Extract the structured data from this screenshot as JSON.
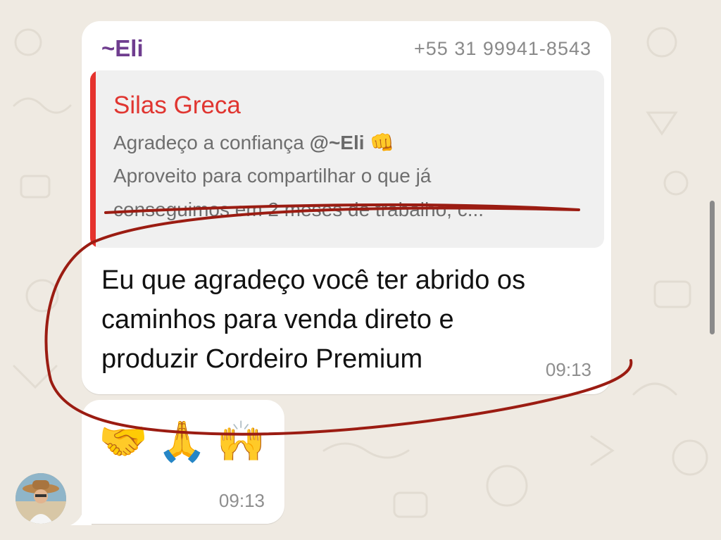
{
  "colors": {
    "wallpaper": "#efeae2",
    "bubble": "#ffffff",
    "sender_name": "#6f3d8f",
    "quote_author": "#e03530",
    "quote_bar": "#e5322d",
    "annotation_stroke": "#9b1c12"
  },
  "message1": {
    "sender_name": "~Eli",
    "sender_phone": "+55 31 99941-8543",
    "quoted": {
      "author": "Silas Greca",
      "line1_text": "Agradeço a confiança ",
      "line1_mention": "@~Eli",
      "line1_emoji": "👊",
      "line2": "Aproveito para compartilhar o que já",
      "line3": "conseguimos em 2 meses de trabalho, c..."
    },
    "text": "Eu que agradeço você ter abrido os caminhos para venda direto e produzir Cordeiro Premium",
    "time": "09:13"
  },
  "message2": {
    "emojis": "🤝🙏🙌",
    "time": "09:13"
  },
  "icons": {
    "avatar": "contact-avatar",
    "annotation": "red-hand-drawn-circle"
  }
}
